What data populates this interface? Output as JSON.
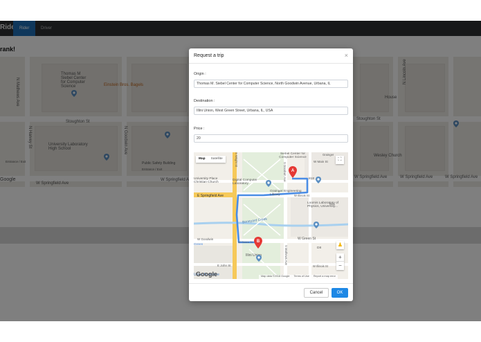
{
  "navbar": {
    "brand": "Ride",
    "tabs": [
      {
        "label": "Rider",
        "active": true
      },
      {
        "label": "Driver",
        "active": false
      }
    ]
  },
  "page": {
    "greeting": "rank!"
  },
  "background_map": {
    "labels": [
      "Thomas M Siebel Center for Computer Science",
      "Einstein Bros. Bagels",
      "Stoughton St",
      "Stoughton St",
      "University Laboratory High School",
      "Public Safety Building",
      "Entrance / Exit",
      "Entrance / Exit",
      "W Springfield Ave",
      "W Springfield Ave",
      "W Springfield Ave",
      "W Springfield Ave",
      "W Springfield Ave",
      "N Mathews Ave",
      "N Goodwin Ave",
      "N Harvey St",
      "N Lincoln Ave",
      "House",
      "Wesley Church",
      "Google"
    ]
  },
  "modal": {
    "title": "Request a trip",
    "close_symbol": "×",
    "origin": {
      "label": "Origin :",
      "value": "Thomas M. Siebel Center for Computer Science, North Goodwin Avenue, Urbana, IL"
    },
    "destination": {
      "label": "Destination :",
      "value": "Illini Union, West Green Street, Urbana, IL, USA"
    },
    "price": {
      "label": "Price :",
      "value": "20"
    },
    "map": {
      "type_buttons": [
        "Map",
        "Satellite"
      ],
      "active_type": "Map",
      "labels": [
        "Siebel Center for Computer Science",
        "W Main St",
        "University Place Christian Church",
        "Digital Computer Laboratory",
        "Grainger Engineering Library",
        "E Springfield Ave",
        "Loomis Laboratory of Physics, University...",
        "Boneyard Creek",
        "W Green St",
        "W Green St",
        "Illini Union",
        "E John St",
        "W Goodwin",
        "Union Bookstore",
        "S Wright St",
        "S Mathews Ave",
        "S Goodwin Ave",
        "W Illinois St",
        "W Illinois St",
        "818",
        "821",
        "D8",
        "Grainger",
        "Green"
      ],
      "markers": [
        "A",
        "B"
      ],
      "zoom_in": "+",
      "zoom_out": "−",
      "attribution": [
        "Map data ©2018 Google",
        "Terms of Use",
        "Report a map error"
      ],
      "logo": "Google"
    },
    "buttons": {
      "cancel": "Cancel",
      "ok": "OK"
    }
  },
  "colors": {
    "accent": "#1e88e5",
    "nav_active": "#1f6fb6",
    "navbar": "#2f3033",
    "route": "#4a8de6",
    "marker": "#e53935"
  }
}
